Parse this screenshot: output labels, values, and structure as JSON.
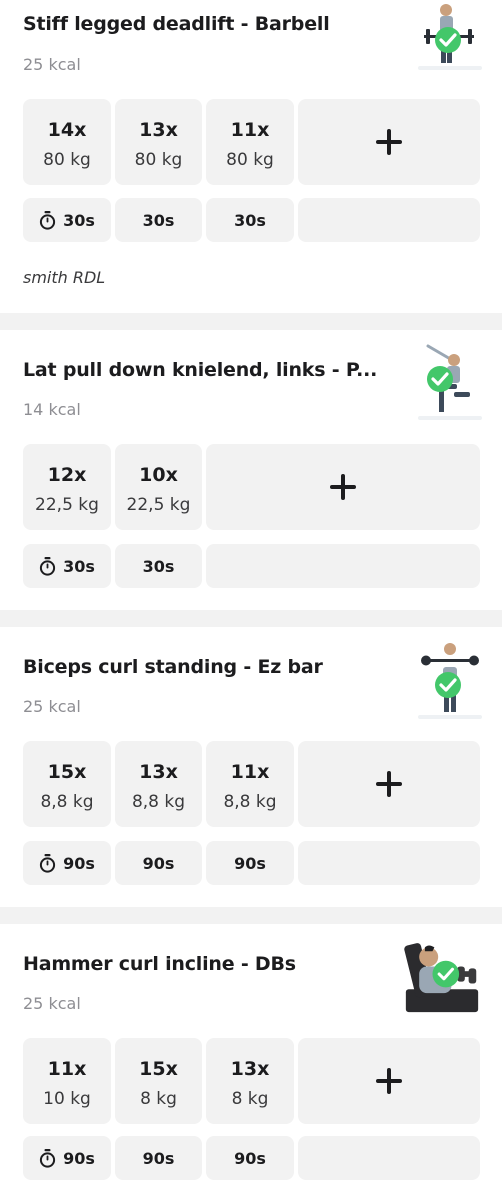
{
  "theme": {
    "accent": "#43c76a",
    "cell_bg": "#f2f2f2",
    "separator": "#f2f2f2"
  },
  "exercises": [
    {
      "title": "Stiff legged deadlift - Barbell",
      "kcal": "25 kcal",
      "completed": true,
      "thumbnail": "person-barbell-deadlift-illustration",
      "sets": [
        {
          "reps": "14x",
          "weight": "80 kg"
        },
        {
          "reps": "13x",
          "weight": "80 kg"
        },
        {
          "reps": "11x",
          "weight": "80 kg"
        }
      ],
      "rests": [
        "30s",
        "30s",
        "30s"
      ],
      "note": "smith RDL"
    },
    {
      "title": "Lat pull down knielend, links - P...",
      "kcal": "14 kcal",
      "completed": true,
      "thumbnail": "person-kneeling-pulldown-illustration",
      "sets": [
        {
          "reps": "12x",
          "weight": "22,5 kg"
        },
        {
          "reps": "10x",
          "weight": "22,5 kg"
        }
      ],
      "rests": [
        "30s",
        "30s"
      ]
    },
    {
      "title": "Biceps curl standing - Ez bar",
      "kcal": "25 kcal",
      "completed": true,
      "thumbnail": "person-ez-bar-curl-illustration",
      "sets": [
        {
          "reps": "15x",
          "weight": "8,8 kg"
        },
        {
          "reps": "13x",
          "weight": "8,8 kg"
        },
        {
          "reps": "11x",
          "weight": "8,8 kg"
        }
      ],
      "rests": [
        "90s",
        "90s",
        "90s"
      ]
    },
    {
      "title": "Hammer curl incline - DBs",
      "kcal": "25 kcal",
      "completed": true,
      "thumbnail": "person-incline-hammer-curl-illustration",
      "sets": [
        {
          "reps": "11x",
          "weight": "10 kg"
        },
        {
          "reps": "15x",
          "weight": "8 kg"
        },
        {
          "reps": "13x",
          "weight": "8 kg"
        }
      ],
      "rests": [
        "90s",
        "90s",
        "90s"
      ]
    }
  ]
}
